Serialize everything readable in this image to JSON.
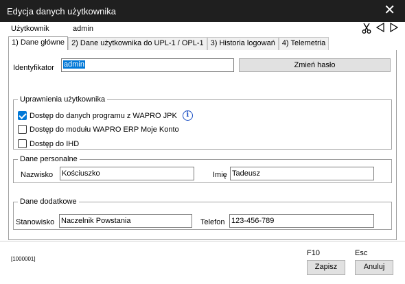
{
  "window": {
    "title": "Edycja danych użytkownika",
    "close_glyph": "✕"
  },
  "userbar": {
    "label": "Użytkownik",
    "value": "admin",
    "icons": {
      "cut": "scissors-icon",
      "prev": "triangle-left-icon",
      "next": "triangle-right-icon"
    }
  },
  "tabs": [
    {
      "label": "1) Dane główne"
    },
    {
      "label": "2) Dane użytkownika do UPL-1 / OPL-1"
    },
    {
      "label": "3) Historia logowań"
    },
    {
      "label": "4) Telemetria"
    }
  ],
  "main": {
    "identifier_label": "Identyfikator",
    "identifier_value": "admin",
    "change_password_label": "Zmień hasło",
    "permissions": {
      "legend": "Uprawnienia użytkownika",
      "items": [
        {
          "label": "Dostęp do danych programu z WAPRO JPK",
          "checked": true
        },
        {
          "label": "Dostęp do modułu WAPRO ERP Moje Konto",
          "checked": false
        },
        {
          "label": "Dostęp do IHD",
          "checked": false
        }
      ],
      "info_glyph": "i"
    },
    "personal": {
      "legend": "Dane personalne",
      "surname_label": "Nazwisko",
      "surname_value": "Kościuszko",
      "name_label": "Imię",
      "name_value": "Tadeusz"
    },
    "extra": {
      "legend": "Dane dodatkowe",
      "position_label": "Stanowisko",
      "position_value": "Naczelnik Powstania",
      "phone_label": "Telefon",
      "phone_value": "123-456-789"
    }
  },
  "footer": {
    "record_id": "[1000001]",
    "save_key": "F10",
    "save_label": "Zapisz",
    "cancel_key": "Esc",
    "cancel_label": "Anuluj"
  },
  "colors": {
    "titlebar": "#1f1f1f",
    "accent": "#0078d7",
    "info": "#1a4fc4"
  }
}
